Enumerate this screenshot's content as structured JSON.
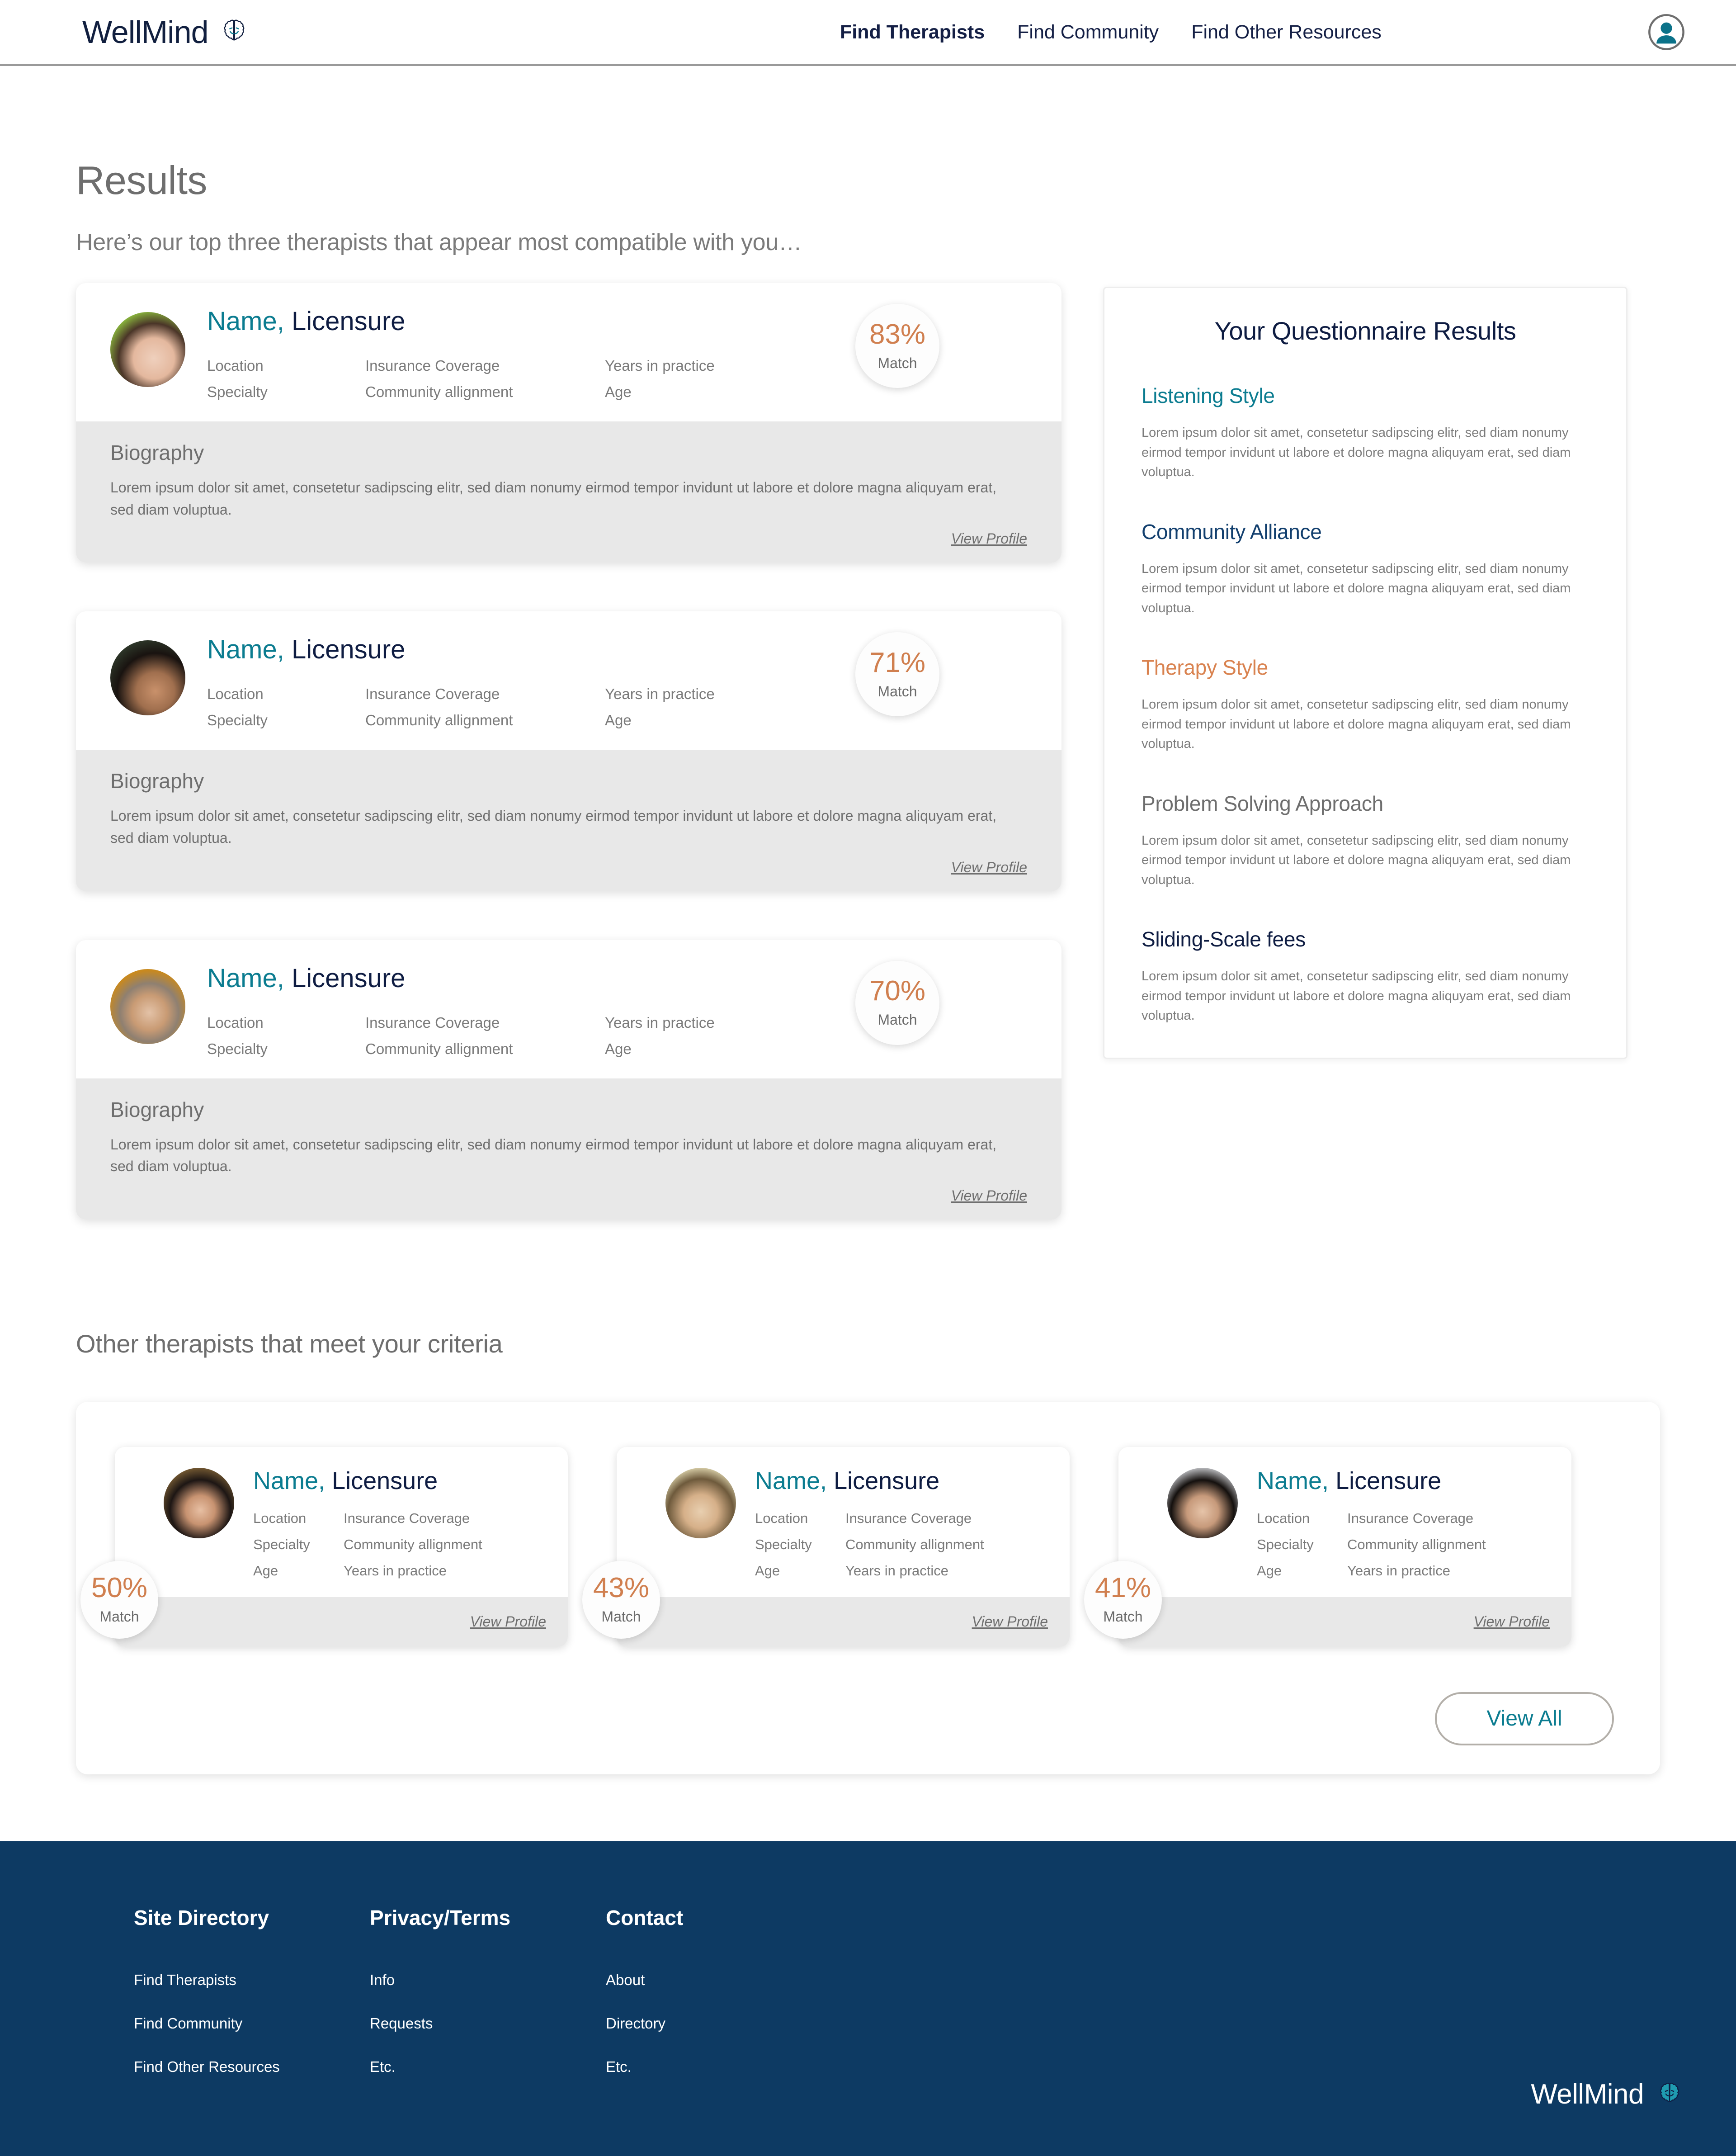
{
  "header": {
    "brand": "WellMind",
    "brand_icon": "brain-icon",
    "nav": [
      {
        "label": "Find Therapists",
        "active": true
      },
      {
        "label": "Find Community",
        "active": false
      },
      {
        "label": "Find Other Resources",
        "active": false
      }
    ],
    "account_icon": "user-account-icon"
  },
  "main": {
    "title": "Results",
    "subtitle": "Here’s our top three therapists that appear most compatible with you…",
    "other_title": "Other therapists that meet your criteria",
    "view_all_label": "View All",
    "view_profile_label": "View Profile",
    "biography_label": "Biography",
    "match_label": "Match",
    "bio_text": "Lorem ipsum dolor sit amet, consetetur sadipscing elitr, sed diam nonumy eirmod tempor invidunt ut labore et dolore magna aliquyam erat, sed diam voluptua."
  },
  "therapists": [
    {
      "name": "Name,",
      "licensure": "Licensure",
      "match": "83%",
      "attrs_col1": [
        "Location",
        "Specialty"
      ],
      "attrs_col2": [
        "Insurance Coverage",
        "Community allignment"
      ],
      "attrs_col3": [
        "Years in practice",
        "Age"
      ],
      "avatar": "avatar-photo-1"
    },
    {
      "name": "Name,",
      "licensure": "Licensure",
      "match": "71%",
      "attrs_col1": [
        "Location",
        "Specialty"
      ],
      "attrs_col2": [
        "Insurance Coverage",
        "Community allignment"
      ],
      "attrs_col3": [
        "Years in practice",
        "Age"
      ],
      "avatar": "avatar-photo-2"
    },
    {
      "name": "Name,",
      "licensure": "Licensure",
      "match": "70%",
      "attrs_col1": [
        "Location",
        "Specialty"
      ],
      "attrs_col2": [
        "Insurance Coverage",
        "Community allignment"
      ],
      "attrs_col3": [
        "Years in practice",
        "Age"
      ],
      "avatar": "avatar-photo-3"
    }
  ],
  "other_therapists": [
    {
      "name": "Name,",
      "licensure": "Licensure",
      "match": "50%",
      "attrs_col1": [
        "Location",
        "Specialty",
        "Age"
      ],
      "attrs_col2": [
        "Insurance Coverage",
        "Community allignment",
        "Years in practice"
      ],
      "avatar": "avatar-photo-4"
    },
    {
      "name": "Name,",
      "licensure": "Licensure",
      "match": "43%",
      "attrs_col1": [
        "Location",
        "Specialty",
        "Age"
      ],
      "attrs_col2": [
        "Insurance Coverage",
        "Community allignment",
        "Years in practice"
      ],
      "avatar": "avatar-photo-5"
    },
    {
      "name": "Name,",
      "licensure": "Licensure",
      "match": "41%",
      "attrs_col1": [
        "Location",
        "Specialty",
        "Age"
      ],
      "attrs_col2": [
        "Insurance Coverage",
        "Community allignment",
        "Years in practice"
      ],
      "avatar": "avatar-photo-6"
    }
  ],
  "questionnaire": {
    "title": "Your Questionnaire Results",
    "sections": [
      {
        "heading": "Listening Style",
        "color": "#0b7c90",
        "body": "Lorem ipsum dolor sit amet, consetetur sadipscing elitr, sed diam nonumy eirmod tempor invidunt ut labore et dolore magna aliquyam erat, sed diam voluptua."
      },
      {
        "heading": "Community Alliance",
        "color": "#123f6e",
        "body": "Lorem ipsum dolor sit amet, consetetur sadipscing elitr, sed diam nonumy eirmod tempor invidunt ut labore et dolore magna aliquyam erat, sed diam voluptua."
      },
      {
        "heading": "Therapy Style",
        "color": "#d9824f",
        "body": "Lorem ipsum dolor sit amet, consetetur sadipscing elitr, sed diam nonumy eirmod tempor invidunt ut labore et dolore magna aliquyam erat, sed diam voluptua."
      },
      {
        "heading": "Problem Solving Approach",
        "color": "#6e6e6e",
        "body": "Lorem ipsum dolor sit amet, consetetur sadipscing elitr, sed diam nonumy eirmod tempor invidunt ut labore et dolore magna aliquyam erat, sed diam voluptua."
      },
      {
        "heading": "Sliding-Scale fees",
        "color": "#0e1c42",
        "body": "Lorem ipsum dolor sit amet, consetetur sadipscing elitr, sed diam nonumy eirmod tempor invidunt ut labore et dolore magna aliquyam erat, sed diam voluptua."
      }
    ]
  },
  "footer": {
    "columns": [
      {
        "heading": "Site Directory",
        "links": [
          "Find Therapists",
          "Find Community",
          "Find Other Resources"
        ]
      },
      {
        "heading": "Privacy/Terms",
        "links": [
          "Info",
          "Requests",
          "Etc."
        ]
      },
      {
        "heading": "Contact",
        "links": [
          "About",
          "Directory",
          "Etc."
        ]
      }
    ],
    "brand": "WellMind",
    "brand_icon": "brain-icon"
  },
  "colors": {
    "teal": "#0b7c90",
    "navy": "#0e1c42",
    "orange": "#d07f4f",
    "footer_bg": "#0d3a63",
    "bio_bg": "#e8e8e8",
    "gray_text": "#6e6e6e"
  }
}
